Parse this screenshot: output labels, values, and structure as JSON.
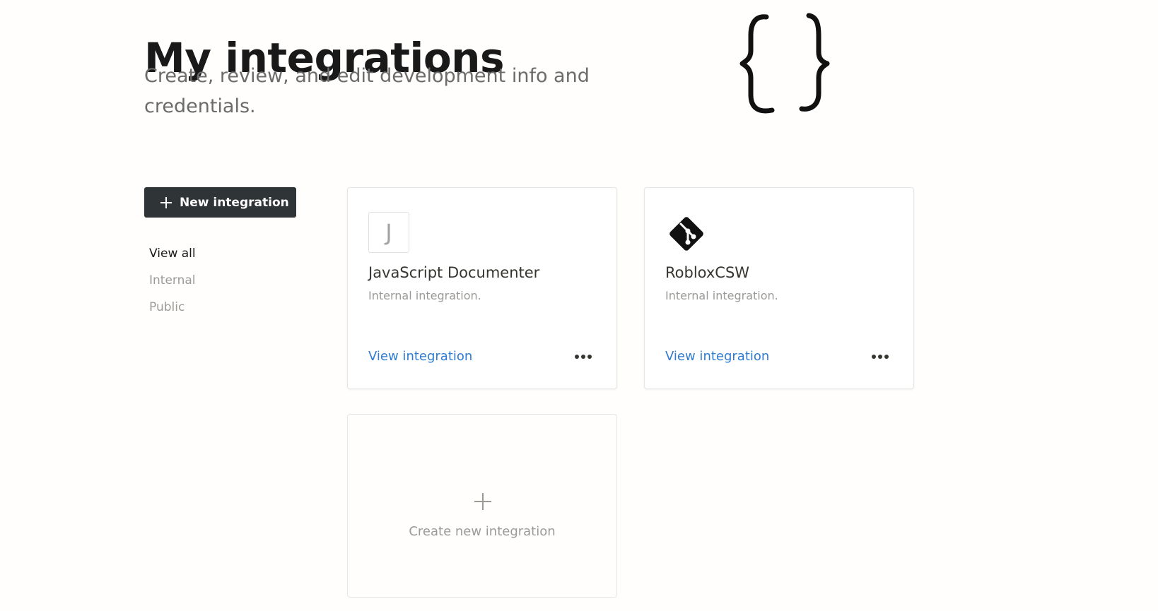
{
  "header": {
    "title": "My integrations",
    "subtitle": "Create, review, and edit development info and credentials."
  },
  "sidebar": {
    "new_button_label": "New integration",
    "filters": [
      {
        "label": "View all",
        "active": true
      },
      {
        "label": "Internal",
        "active": false
      },
      {
        "label": "Public",
        "active": false
      }
    ]
  },
  "integrations": [
    {
      "icon": "letter-j-placeholder-icon",
      "icon_letter": "J",
      "name": "JavaScript Documenter",
      "description": "Internal integration.",
      "link_label": "View integration"
    },
    {
      "icon": "git-logo-icon",
      "name": "RobloxCSW",
      "description": "Internal integration.",
      "link_label": "View integration"
    }
  ],
  "create_card": {
    "label": "Create new integration"
  },
  "colors": {
    "button_bg": "#2f3437",
    "link": "#2e7bd1",
    "muted_text": "#9b9a97",
    "background": "#fffefd"
  }
}
